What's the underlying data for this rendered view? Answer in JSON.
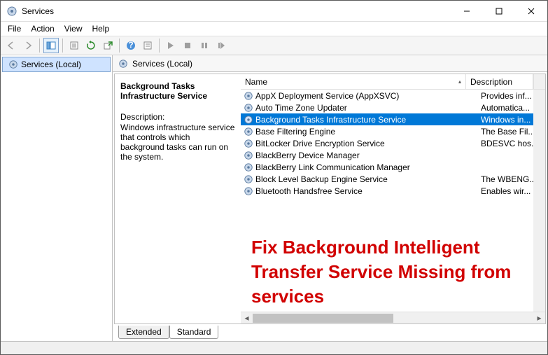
{
  "window": {
    "title": "Services"
  },
  "menubar": {
    "file": "File",
    "action": "Action",
    "view": "View",
    "help": "Help"
  },
  "tree": {
    "root": "Services (Local)"
  },
  "paneheader": "Services (Local)",
  "detail": {
    "name": "Background Tasks Infrastructure Service",
    "descLabel": "Description:",
    "desc": "Windows infrastructure service that controls which background tasks can run on the system."
  },
  "columns": {
    "name": "Name",
    "description": "Description"
  },
  "services": [
    {
      "name": "AppX Deployment Service (AppXSVC)",
      "desc": "Provides inf...",
      "selected": false
    },
    {
      "name": "Auto Time Zone Updater",
      "desc": "Automatica...",
      "selected": false
    },
    {
      "name": "Background Tasks Infrastructure Service",
      "desc": "Windows in...",
      "selected": true
    },
    {
      "name": "Base Filtering Engine",
      "desc": "The Base Fil...",
      "selected": false
    },
    {
      "name": "BitLocker Drive Encryption Service",
      "desc": "BDESVC hos...",
      "selected": false
    },
    {
      "name": "BlackBerry Device Manager",
      "desc": "",
      "selected": false
    },
    {
      "name": "BlackBerry Link Communication Manager",
      "desc": "",
      "selected": false
    },
    {
      "name": "Block Level Backup Engine Service",
      "desc": "The WBENG...",
      "selected": false
    },
    {
      "name": "Bluetooth Handsfree Service",
      "desc": "Enables wir...",
      "selected": false
    }
  ],
  "tabs": {
    "extended": "Extended",
    "standard": "Standard"
  },
  "overlay": "Fix Background Intelligent Transfer Service Missing from services"
}
